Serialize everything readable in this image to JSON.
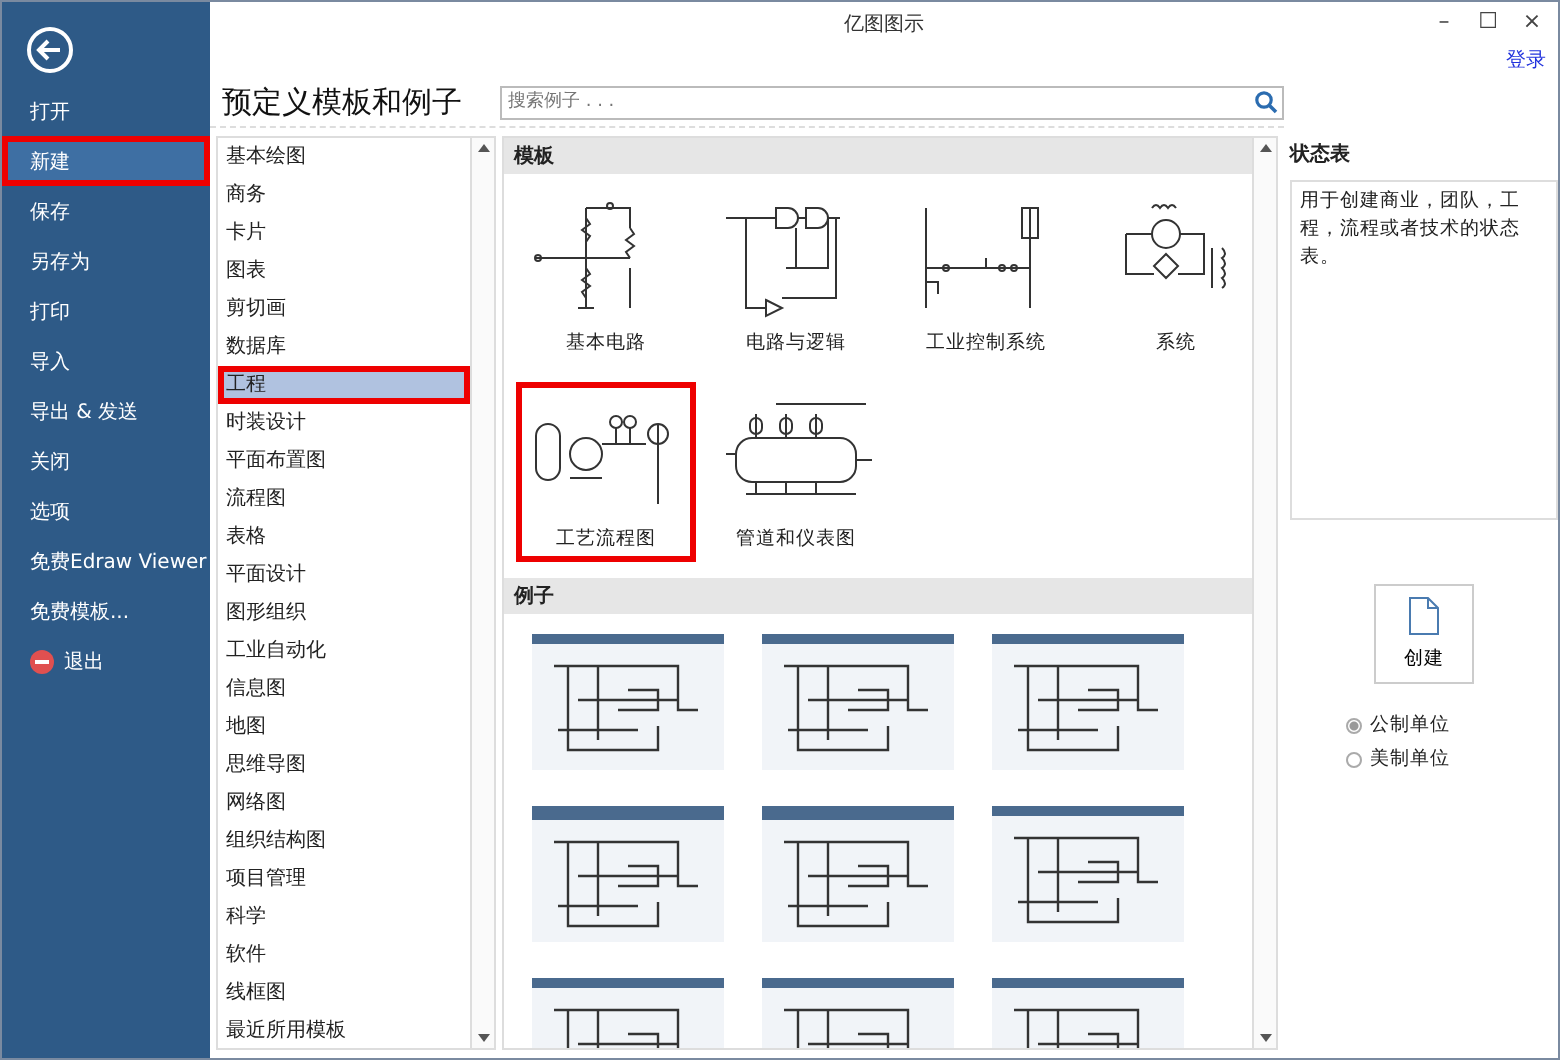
{
  "window": {
    "title": "亿图图示",
    "controls": [
      "–",
      "☐",
      "×"
    ]
  },
  "login": "登录",
  "sidebar": {
    "items": [
      {
        "label": "打开",
        "selected": false,
        "kind": "text"
      },
      {
        "label": "新建",
        "selected": true,
        "kind": "text"
      },
      {
        "label": "保存",
        "selected": false,
        "kind": "text"
      },
      {
        "label": "另存为",
        "selected": false,
        "kind": "text"
      },
      {
        "label": "打印",
        "selected": false,
        "kind": "text"
      },
      {
        "label": "导入",
        "selected": false,
        "kind": "text"
      },
      {
        "label": "导出 & 发送",
        "selected": false,
        "kind": "text"
      },
      {
        "label": "关闭",
        "selected": false,
        "kind": "text"
      },
      {
        "label": "选项",
        "selected": false,
        "kind": "text"
      },
      {
        "label": "免费Edraw Viewer",
        "selected": false,
        "kind": "text"
      },
      {
        "label": "免费模板...",
        "selected": false,
        "kind": "text"
      },
      {
        "label": "退出",
        "selected": false,
        "kind": "exit"
      }
    ]
  },
  "heading": "预定义模板和例子",
  "search": {
    "placeholder": "搜索例子 . . ."
  },
  "categories": [
    {
      "label": "基本绘图",
      "selected": false
    },
    {
      "label": "商务",
      "selected": false
    },
    {
      "label": "卡片",
      "selected": false
    },
    {
      "label": "图表",
      "selected": false
    },
    {
      "label": "剪切画",
      "selected": false
    },
    {
      "label": "数据库",
      "selected": false
    },
    {
      "label": "工程",
      "selected": true
    },
    {
      "label": "时装设计",
      "selected": false
    },
    {
      "label": "平面布置图",
      "selected": false
    },
    {
      "label": "流程图",
      "selected": false
    },
    {
      "label": "表格",
      "selected": false
    },
    {
      "label": "平面设计",
      "selected": false
    },
    {
      "label": "图形组织",
      "selected": false
    },
    {
      "label": "工业自动化",
      "selected": false
    },
    {
      "label": "信息图",
      "selected": false
    },
    {
      "label": "地图",
      "selected": false
    },
    {
      "label": "思维导图",
      "selected": false
    },
    {
      "label": "网络图",
      "selected": false
    },
    {
      "label": "组织结构图",
      "selected": false
    },
    {
      "label": "项目管理",
      "selected": false
    },
    {
      "label": "科学",
      "selected": false
    },
    {
      "label": "软件",
      "selected": false
    },
    {
      "label": "线框图",
      "selected": false
    },
    {
      "label": "最近所用模板",
      "selected": false
    }
  ],
  "templates": {
    "title": "模板",
    "items": [
      {
        "label": "基本电路",
        "kind": "circuit",
        "selected": false
      },
      {
        "label": "电路与逻辑",
        "kind": "logic",
        "selected": false
      },
      {
        "label": "工业控制系统",
        "kind": "control",
        "selected": false
      },
      {
        "label": "系统",
        "kind": "system",
        "selected": false
      },
      {
        "label": "工艺流程图",
        "kind": "process",
        "selected": true
      },
      {
        "label": "管道和仪表图",
        "kind": "piping",
        "selected": false
      }
    ]
  },
  "examples": {
    "title": "例子",
    "items": [
      {
        "kind": "plain"
      },
      {
        "kind": "plain"
      },
      {
        "kind": "plain"
      },
      {
        "kind": "wavy"
      },
      {
        "kind": "wavy"
      },
      {
        "kind": "plain"
      },
      {
        "kind": "plain"
      },
      {
        "kind": "plain"
      },
      {
        "kind": "plain"
      }
    ]
  },
  "details": {
    "title": "状态表",
    "description": "用于创建商业，团队，工程，流程或者技术的状态表。",
    "create": "创建",
    "units": [
      {
        "label": "公制单位",
        "selected": true
      },
      {
        "label": "美制单位",
        "selected": false
      }
    ]
  }
}
